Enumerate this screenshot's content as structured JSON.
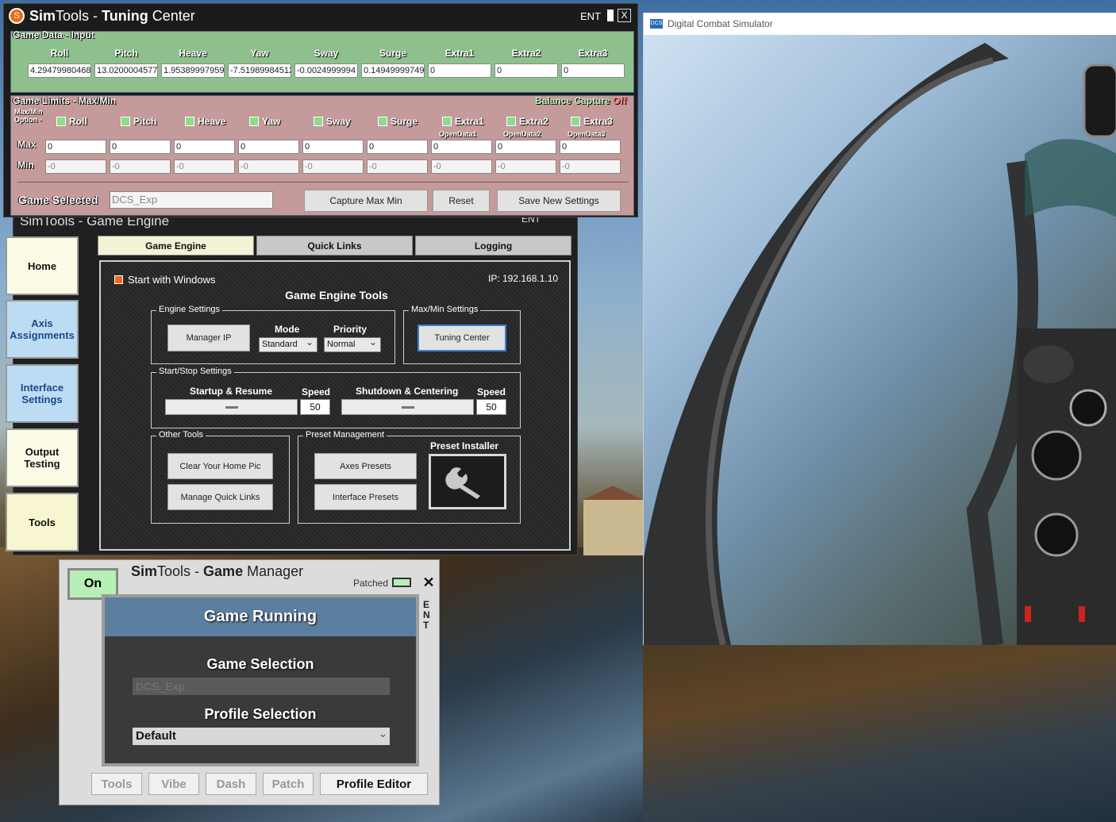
{
  "dcs_window": {
    "title": "Digital Combat Simulator",
    "logo": "DCS"
  },
  "tuning_center": {
    "title_sim": "Sim",
    "title_tools": "Tools - ",
    "title_tuning": "Tuning",
    "title_center": " Center",
    "ent": "ENT",
    "restore_glyph": "▐",
    "close_glyph": "X",
    "game_data_label": "Game Data - Input",
    "axis_headers": [
      "Roll",
      "Pitch",
      "Heave",
      "Yaw",
      "Sway",
      "Surge",
      "Extra1",
      "Extra2",
      "Extra3"
    ],
    "axis_values": [
      "4.29479980468",
      "13.0200004577",
      "1.95389997959",
      "-7.51989984512",
      "-0.0024999994",
      "0.14949999749",
      "0",
      "0",
      "0"
    ],
    "game_limits_label": "Game Limits - Max/Min",
    "balance_capture": "Balance Capture",
    "balance_state": "Off",
    "maxmin_option_label1": "Max/Min",
    "maxmin_option_label2": "Option -",
    "option_labels": [
      "Roll",
      "Pitch",
      "Heave",
      "Yaw",
      "Sway",
      "Surge",
      "Extra1",
      "Extra2",
      "Extra3"
    ],
    "opendata": [
      "OpenData1",
      "OpenData2",
      "OpenData3"
    ],
    "max_label": "Max",
    "min_label": "Min",
    "max_values": [
      "0",
      "0",
      "0",
      "0",
      "0",
      "0",
      "0",
      "0",
      "0"
    ],
    "min_values": [
      "-0",
      "-0",
      "-0",
      "-0",
      "-0",
      "-0",
      "-0",
      "-0",
      "-0"
    ],
    "game_selected_label": "Game Selected",
    "game_selected_value": "DCS_Exp",
    "capture_btn": "Capture Max Min",
    "reset_btn": "Reset",
    "save_btn": "Save New Settings"
  },
  "game_engine": {
    "title": "SimTools - Game Engine",
    "ent": "ENT",
    "nav": [
      "Home",
      "Axis Assignments",
      "Interface Settings",
      "Output Testing",
      "Tools"
    ],
    "tabs": [
      "Game Engine",
      "Quick Links",
      "Logging"
    ],
    "start_with_windows": "Start with Windows",
    "ip": "IP: 192.168.1.10",
    "tools_title": "Game Engine Tools",
    "engine_settings": "Engine Settings",
    "manager_ip": "Manager IP",
    "mode_label": "Mode",
    "mode_value": "Standard",
    "priority_label": "Priority",
    "priority_value": "Normal",
    "maxmin_settings": "Max/Min Settings",
    "tuning_center_btn": "Tuning Center",
    "startstop": "Start/Stop Settings",
    "startup_resume": "Startup & Resume",
    "speed_label": "Speed",
    "speed1": "50",
    "shutdown_centering": "Shutdown & Centering",
    "speed2": "50",
    "other_tools": "Other Tools",
    "clear_home_pic": "Clear Your Home Pic",
    "manage_quick_links": "Manage Quick Links",
    "preset_mgmt": "Preset Management",
    "axes_presets": "Axes Presets",
    "interface_presets": "Interface Presets",
    "preset_installer": "Preset Installer"
  },
  "game_manager": {
    "on_btn": "On",
    "title_sim": "Sim",
    "title_tools": "Tools - ",
    "title_game": "Game",
    "title_manager": " Manager",
    "patched": "Patched",
    "close_glyph": "✕",
    "ent_vertical": "ENT",
    "status": "Game Running",
    "game_selection": "Game Selection",
    "game_value": "DCS_Exp",
    "profile_selection": "Profile Selection",
    "profile_value": "Default",
    "bottom_buttons": [
      "Tools",
      "Vibe",
      "Dash",
      "Patch",
      "Profile Editor"
    ]
  },
  "colors": {
    "green": "#8ec08e",
    "rose": "#c49a9a",
    "accent_orange": "#e96d18",
    "status_blue": "#5d7f9f"
  }
}
